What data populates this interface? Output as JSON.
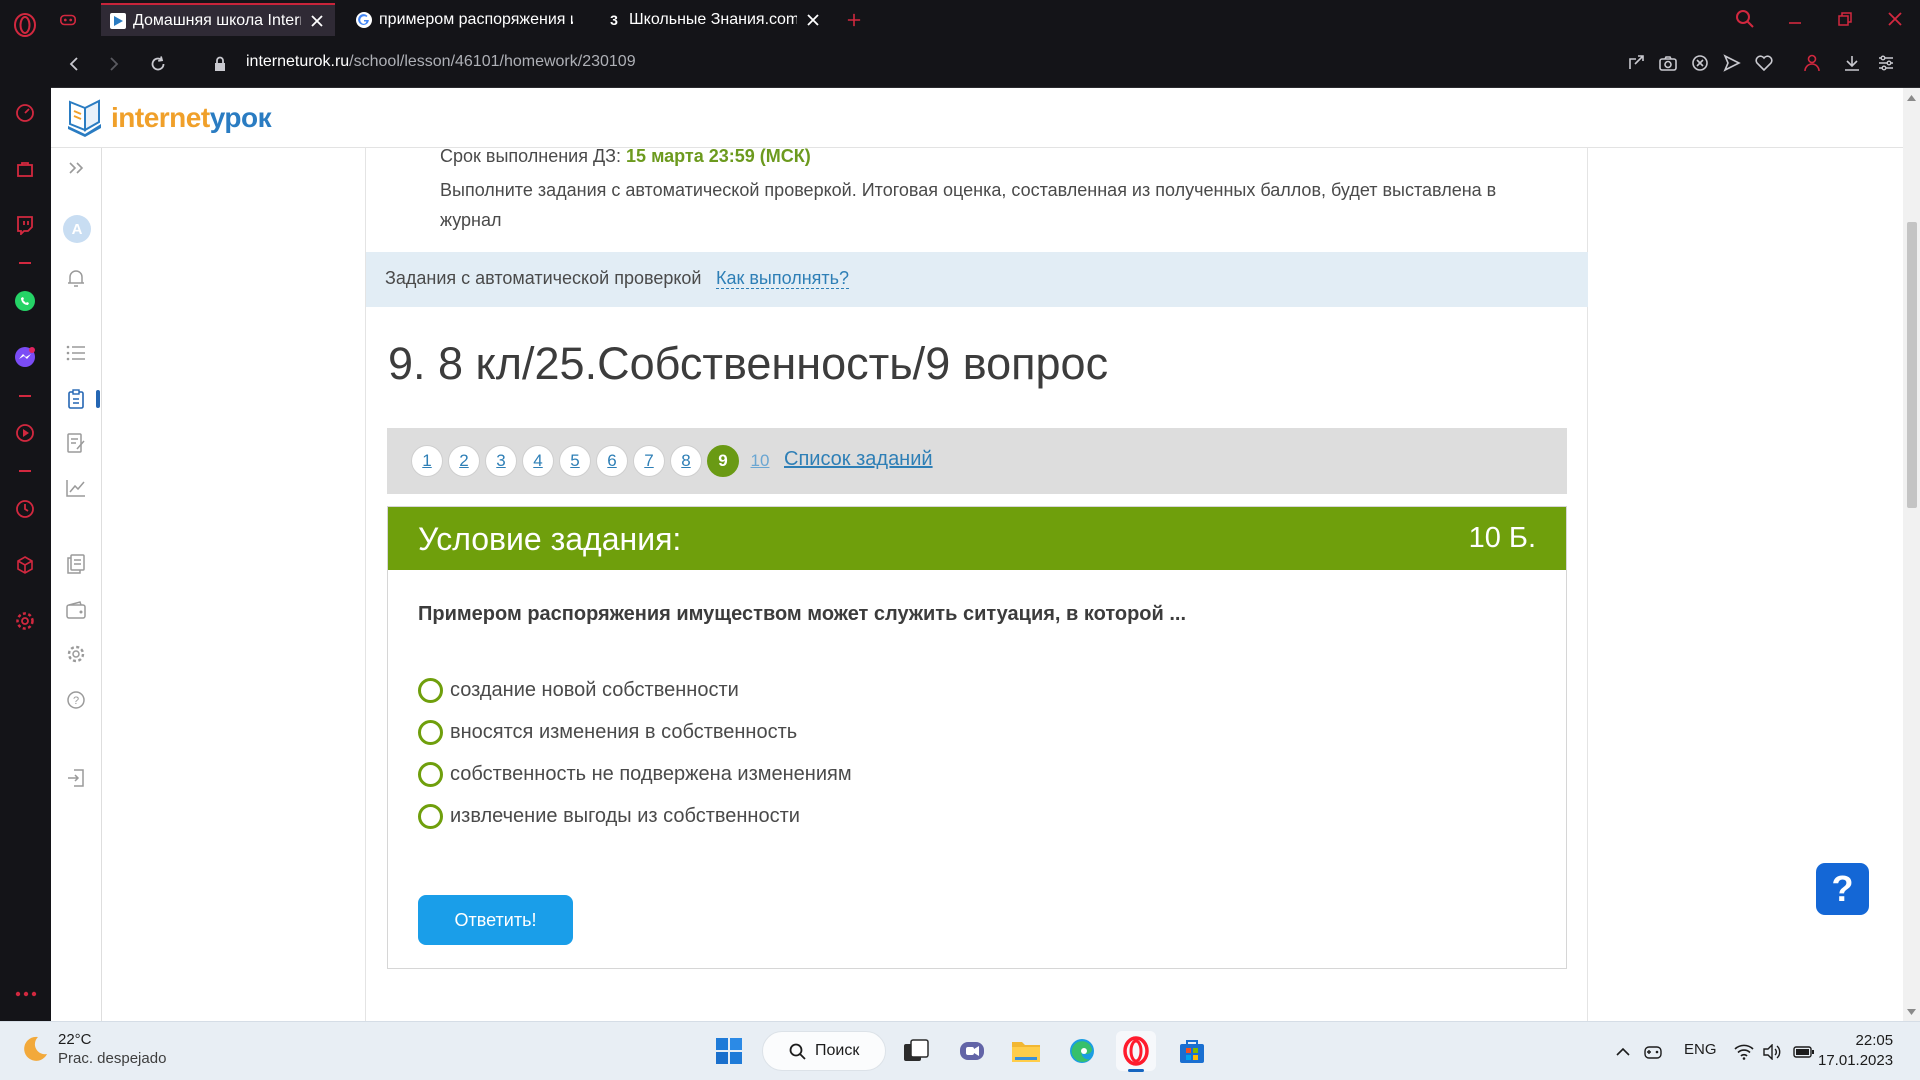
{
  "browser": {
    "tabs": [
      {
        "title": "Домашняя школа InternetУрок",
        "active": true
      },
      {
        "title": "примером распоряжения имуществом",
        "active": false
      },
      {
        "title": "Школьные Знания.com - Решаем",
        "active": false
      }
    ],
    "url_domain": "interneturok.ru",
    "url_path": "/school/lesson/46101/homework/230109",
    "accent_color": "#c8243a"
  },
  "site": {
    "logo_part1": "internet",
    "logo_part2": "урок",
    "sidebar_avatar": "A"
  },
  "homework": {
    "deadline_label": "Срок выполнения ДЗ:",
    "deadline_value": "15 марта 23:59 (МСК)",
    "instructions": "Выполните задания с автоматической проверкой. Итоговая оценка, составленная из полученных баллов, будет выставлена в журнал",
    "auto_check_label": "Задания с автоматической проверкой",
    "how_to_link": "Как выполнять?",
    "task_title": "9. 8 кл/25.Собственность/9 вопрос",
    "pager": {
      "pages": [
        "1",
        "2",
        "3",
        "4",
        "5",
        "6",
        "7",
        "8",
        "9",
        "10"
      ],
      "current": "9",
      "list_link": "Список заданий"
    },
    "task": {
      "header": "Условие задания:",
      "points": "10 Б.",
      "question": "Примером распоряжения имуществом может служить ситуация, в которой ...",
      "options": [
        "создание новой собственности",
        "вносятся изменения в собственность",
        "собственность не подвержена изменениям",
        "извлечение выгоды из собственности"
      ],
      "submit_label": "Ответить!"
    },
    "help_label": "?",
    "colors": {
      "green": "#6f9f0c",
      "blue_button": "#1a9ee9",
      "help_button": "#1467d6"
    }
  },
  "taskbar": {
    "temperature": "22°C",
    "weather": "Prac. despejado",
    "search_label": "Поиск",
    "language": "ENG",
    "time": "22:05",
    "date": "17.01.2023"
  }
}
